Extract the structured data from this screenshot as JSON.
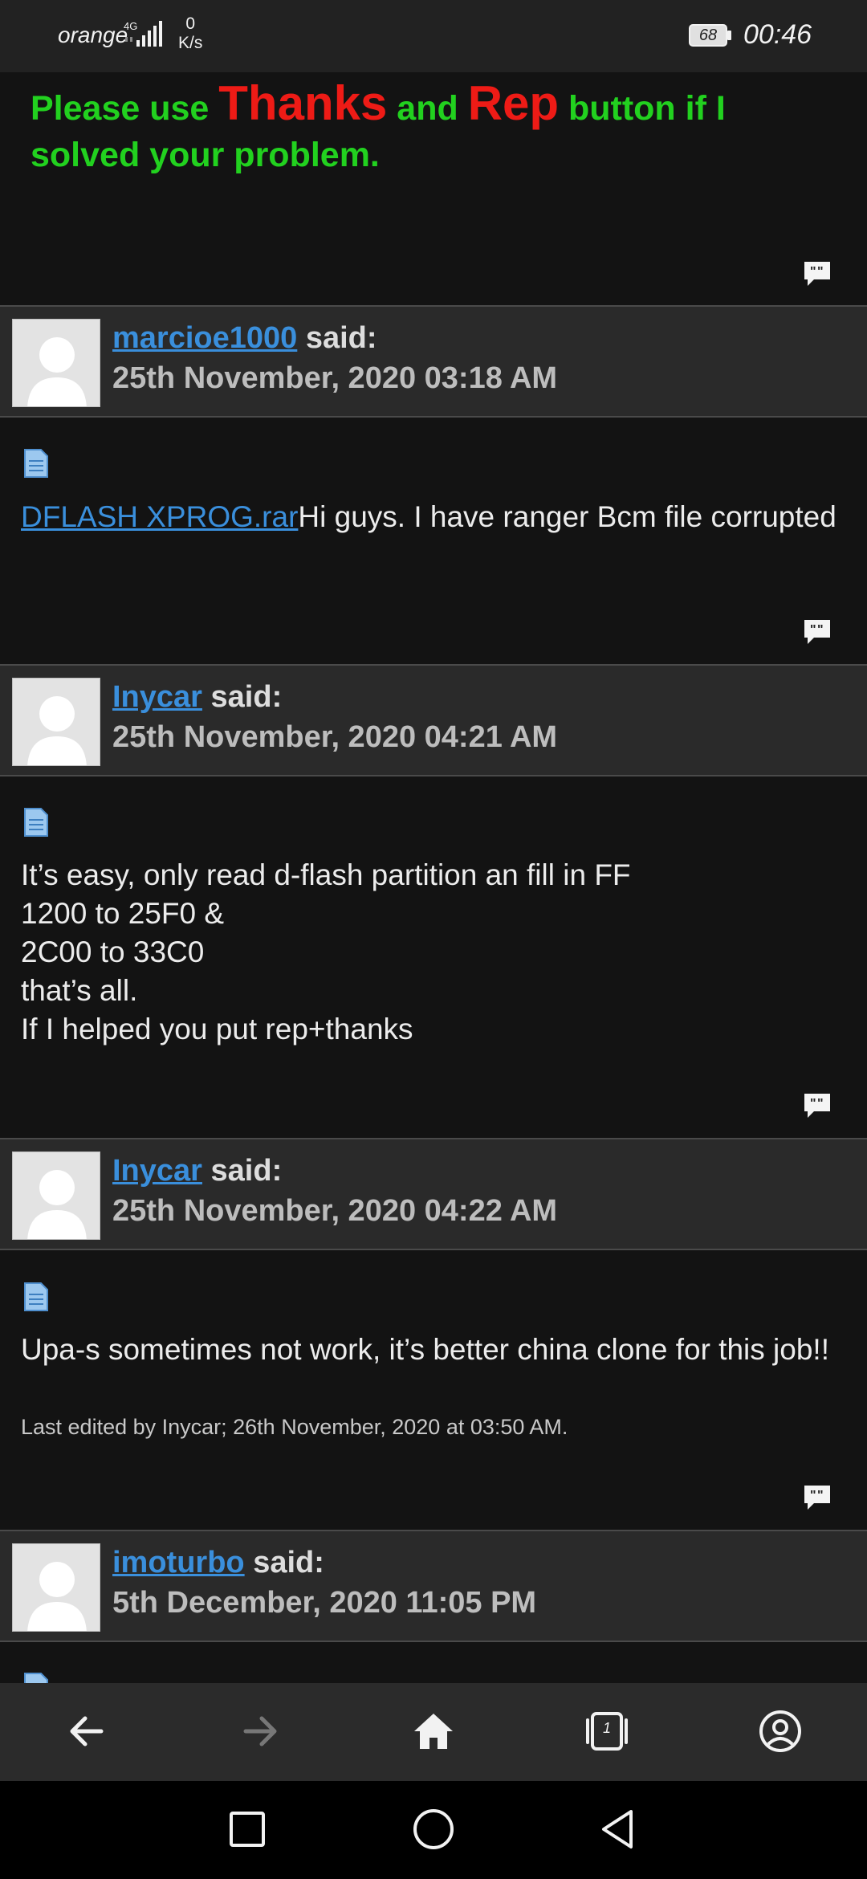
{
  "status_bar": {
    "carrier": "orange",
    "network": "4G",
    "speed_value": "0",
    "speed_unit": "K/s",
    "battery": "68",
    "time": "00:46"
  },
  "signature": {
    "part1": "Please use ",
    "thanks": "Thanks",
    "part2": " and ",
    "rep": "Rep",
    "part3": " button if I solved your problem."
  },
  "posts": [
    {
      "username": "marcioe1000",
      "said": " said:",
      "date": "25th November, 2020 03:18 AM",
      "attachment": "DFLASH XPROG.rar",
      "body": "Hi guys. I have ranger Bcm file corrupted"
    },
    {
      "username": "Inycar",
      "said": " said:",
      "date": "25th November, 2020 04:21 AM",
      "lines": [
        "It’s easy, only read d-flash partition an fill in FF",
        "1200 to 25F0 &",
        "2C00 to 33C0",
        "that’s all.",
        "If I helped you put rep+thanks"
      ]
    },
    {
      "username": "Inycar",
      "said": " said:",
      "date": "25th November, 2020 04:22 AM",
      "body": "Upa-s sometimes not work, it’s better china clone for this job!!",
      "edit_note": "Last edited by Inycar; 26th November, 2020 at 03:50 AM."
    },
    {
      "username": "imoturbo",
      "said": " said:",
      "date": "5th December, 2020 11:05 PM"
    }
  ],
  "browser_nav": {
    "tab_count": "1"
  },
  "colors": {
    "signature_green": "#22d11f",
    "signature_red": "#ee1b16",
    "link_blue": "#3a8fdc"
  }
}
